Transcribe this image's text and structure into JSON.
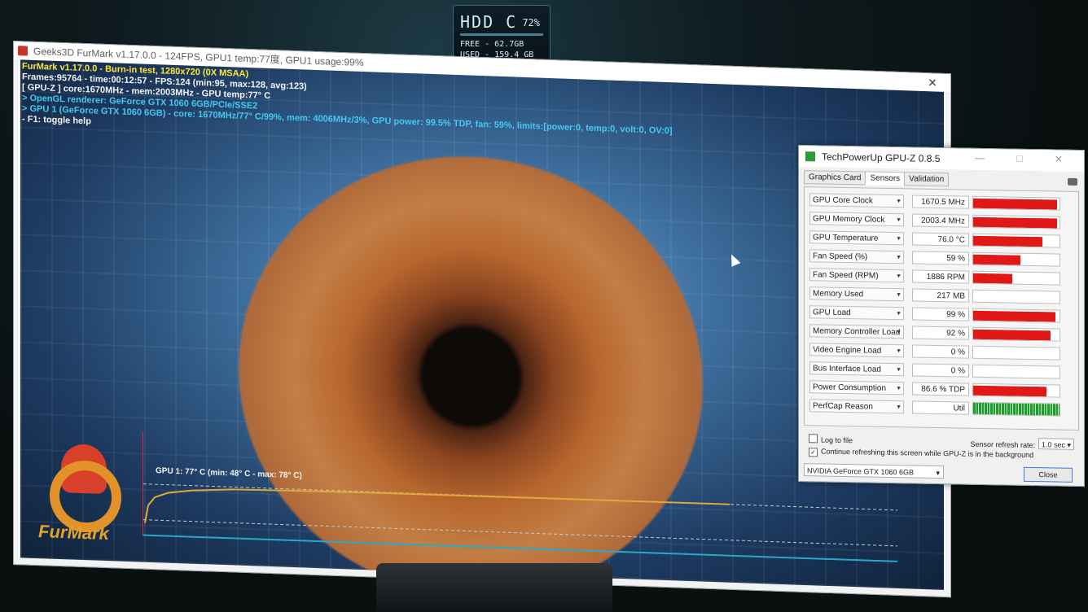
{
  "hud": {
    "title": "HDD C",
    "percent": "72%",
    "free": "FREE - 62.7GB",
    "used": "USED - 159.4 GB"
  },
  "furmark": {
    "window_title": "Geeks3D FurMark v1.17.0.0 - 124FPS, GPU1 temp:77度, GPU1 usage:99%",
    "close": "✕",
    "osd": {
      "line1": "FurMark v1.17.0.0 - Burn-in test, 1280x720 (0X MSAA)",
      "line2": "Frames:95764 - time:00:12:57 - FPS:124 (min:95, max:128, avg:123)",
      "line3": "[ GPU-Z ] core:1670MHz - mem:2003MHz - GPU temp:77° C",
      "line4": "> OpenGL renderer: GeForce GTX 1060 6GB/PCIe/SSE2",
      "line5": "> GPU 1 (GeForce GTX 1060 6GB) - core: 1670MHz/77° C/99%, mem: 4006MHz/3%, GPU power: 99.5% TDP, fan: 59%, limits:[power:0, temp:0, volt:0, OV:0]",
      "line6": "- F1: toggle help"
    },
    "graph_label": "GPU 1: 77° C (min: 48° C - max: 78° C)",
    "logo_text": "FurMark"
  },
  "gpuz": {
    "title": "TechPowerUp GPU-Z 0.8.5",
    "window_controls": "— □ ✕",
    "tabs": [
      "Graphics Card",
      "Sensors",
      "Validation"
    ],
    "sensors": [
      {
        "label": "GPU Core Clock",
        "value": "1670.5 MHz",
        "level": 0.97,
        "kind": "red"
      },
      {
        "label": "GPU Memory Clock",
        "value": "2003.4 MHz",
        "level": 0.97,
        "kind": "red"
      },
      {
        "label": "GPU Temperature",
        "value": "76.0 °C",
        "level": 0.8,
        "kind": "red"
      },
      {
        "label": "Fan Speed (%)",
        "value": "59 %",
        "level": 0.55,
        "kind": "red"
      },
      {
        "label": "Fan Speed (RPM)",
        "value": "1886 RPM",
        "level": 0.45,
        "kind": "red"
      },
      {
        "label": "Memory Used",
        "value": "217 MB",
        "level": 0.0,
        "kind": "red"
      },
      {
        "label": "GPU Load",
        "value": "99 %",
        "level": 0.95,
        "kind": "red"
      },
      {
        "label": "Memory Controller Load",
        "value": "92 %",
        "level": 0.9,
        "kind": "red"
      },
      {
        "label": "Video Engine Load",
        "value": "0 %",
        "level": 0.0,
        "kind": "red"
      },
      {
        "label": "Bus Interface Load",
        "value": "0 %",
        "level": 0.0,
        "kind": "red"
      },
      {
        "label": "Power Consumption",
        "value": "86.6 % TDP",
        "level": 0.85,
        "kind": "red"
      },
      {
        "label": "PerfCap Reason",
        "value": "Util",
        "level": 1.0,
        "kind": "green"
      }
    ],
    "log_to_file": "Log to file",
    "continue_refresh": "Continue refreshing this screen while GPU-Z is in the background",
    "refresh_rate_label": "Sensor refresh rate:",
    "refresh_rate_value": "1.0 sec",
    "card_select": "NVIDIA GeForce GTX 1060 6GB",
    "close_button": "Close"
  }
}
